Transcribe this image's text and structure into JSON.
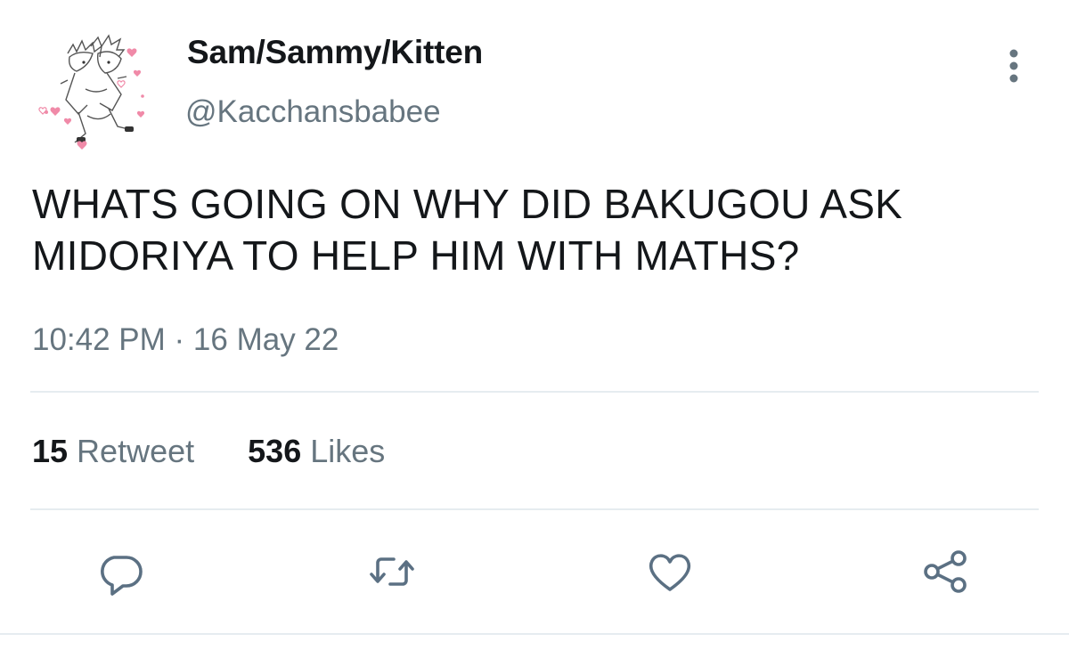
{
  "tweet": {
    "display_name": "Sam/Sammy/Kitten",
    "handle": "@Kacchansbabee",
    "text": "WHATS GOING ON WHY DID BAKUGOU ASK\nMIDORIYA TO HELP HIM WITH MATHS?",
    "timestamp": "10:42 PM · 16 May 22",
    "retweet_count": "15",
    "retweet_label": "Retweet",
    "like_count": "536",
    "like_label": "Likes"
  },
  "icons": {
    "more": "more-vertical-icon",
    "reply": "reply-icon",
    "retweet": "retweet-icon",
    "like": "heart-icon",
    "share": "share-icon"
  },
  "colors": {
    "text": "#14171a",
    "secondary": "#66757f",
    "divider": "#e6ecf0",
    "icon": "#5b7083"
  }
}
